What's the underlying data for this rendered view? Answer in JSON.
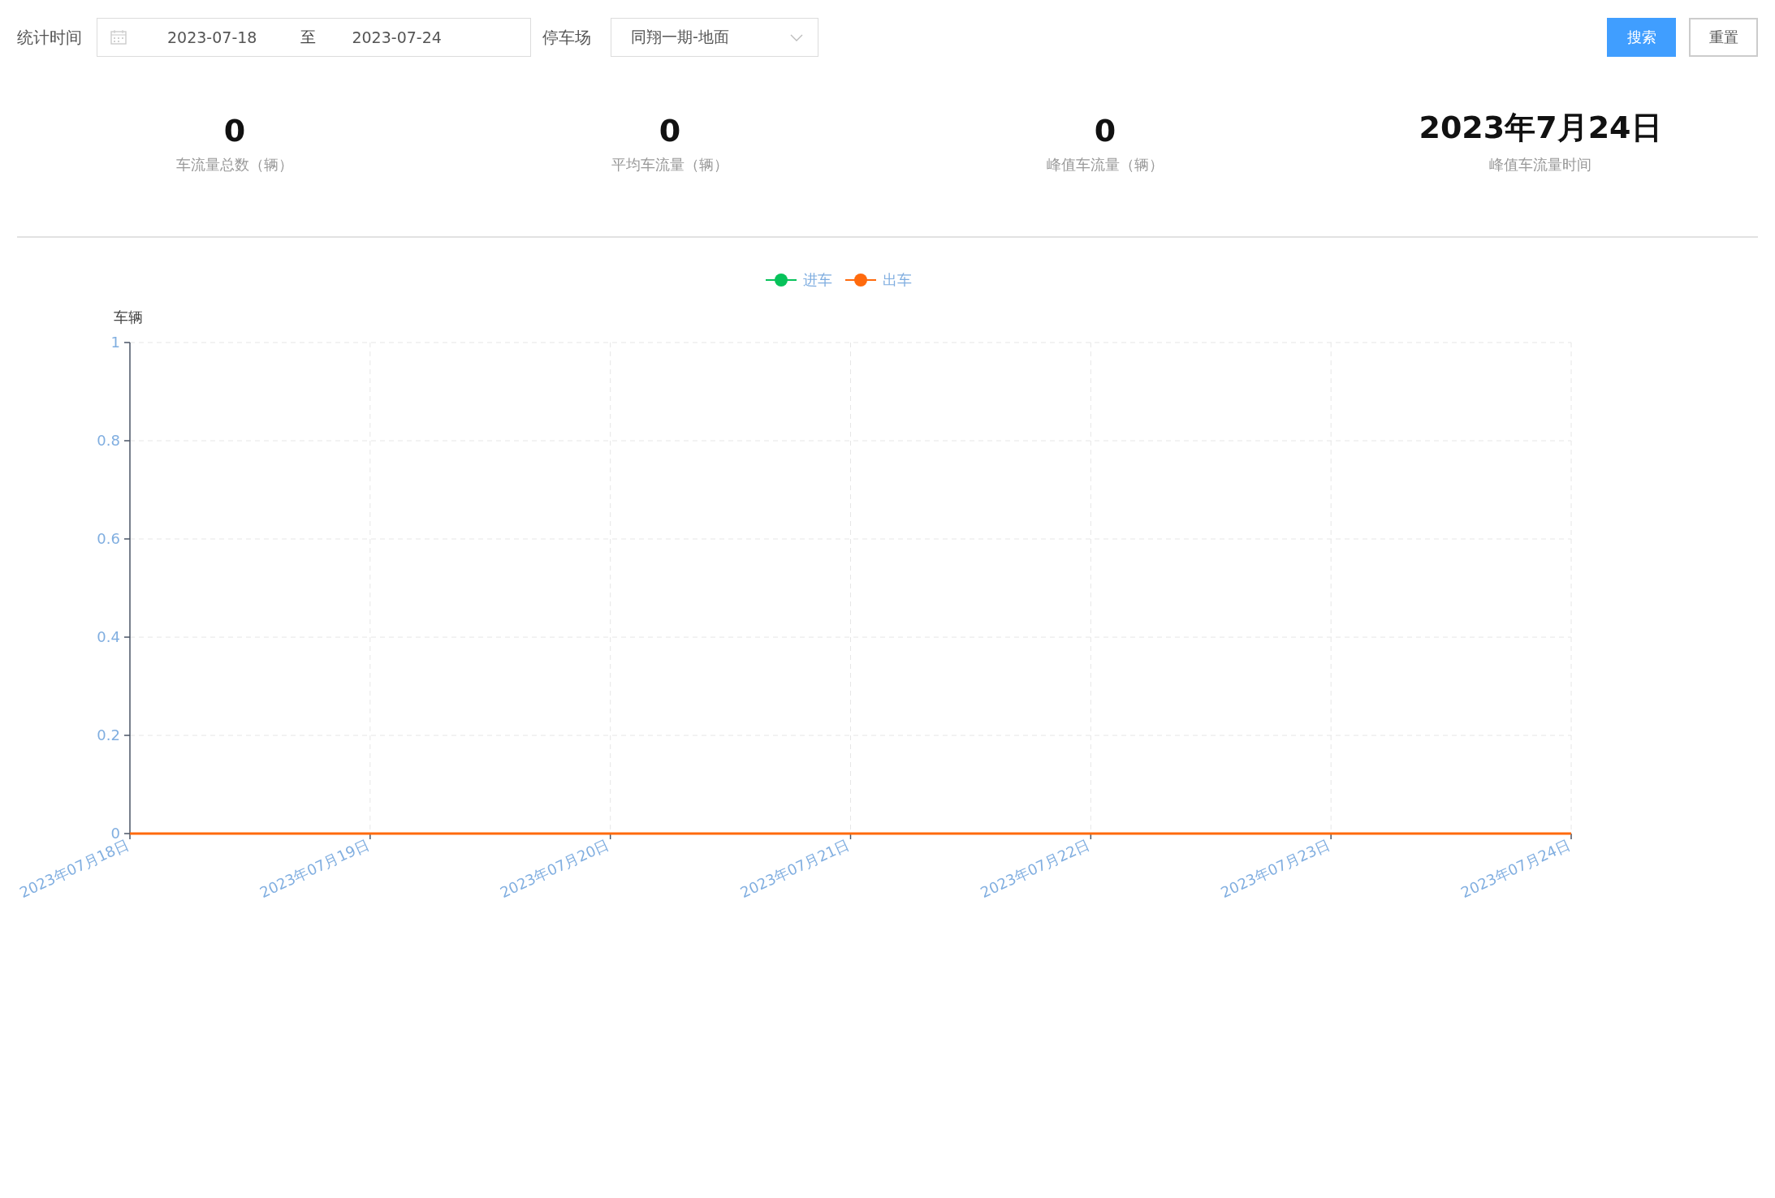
{
  "filters": {
    "time_label": "统计时间",
    "start_date": "2023-07-18",
    "separator": "至",
    "end_date": "2023-07-24",
    "lot_label": "停车场",
    "lot_value": "同翔一期-地面"
  },
  "buttons": [
    {
      "kind": "primary",
      "label": "搜索"
    },
    {
      "kind": "default",
      "label": "重置"
    }
  ],
  "stats": [
    {
      "value": "0",
      "label": "车流量总数（辆）"
    },
    {
      "value": "0",
      "label": "平均车流量（辆）"
    },
    {
      "value": "0",
      "label": "峰值车流量（辆）"
    },
    {
      "value": "2023年7月24日",
      "label": "峰值车流量时间"
    }
  ],
  "chart_data": {
    "type": "line",
    "grid": true,
    "ylabel": "车辆",
    "categories": [
      "2023年07月18日",
      "2023年07月19日",
      "2023年07月20日",
      "2023年07月21日",
      "2023年07月22日",
      "2023年07月23日",
      "2023年07月24日"
    ],
    "ylim": [
      0,
      1
    ],
    "yticks": [
      0,
      0.2,
      0.4,
      0.6,
      0.8,
      1
    ],
    "series": [
      {
        "name": "进车",
        "color": "#07c25a",
        "values": [
          null,
          null,
          null,
          null,
          null,
          null,
          null
        ]
      },
      {
        "name": "出车",
        "color": "#ff6a0d",
        "values": [
          0,
          0,
          0,
          0,
          0,
          0,
          0
        ]
      }
    ]
  }
}
